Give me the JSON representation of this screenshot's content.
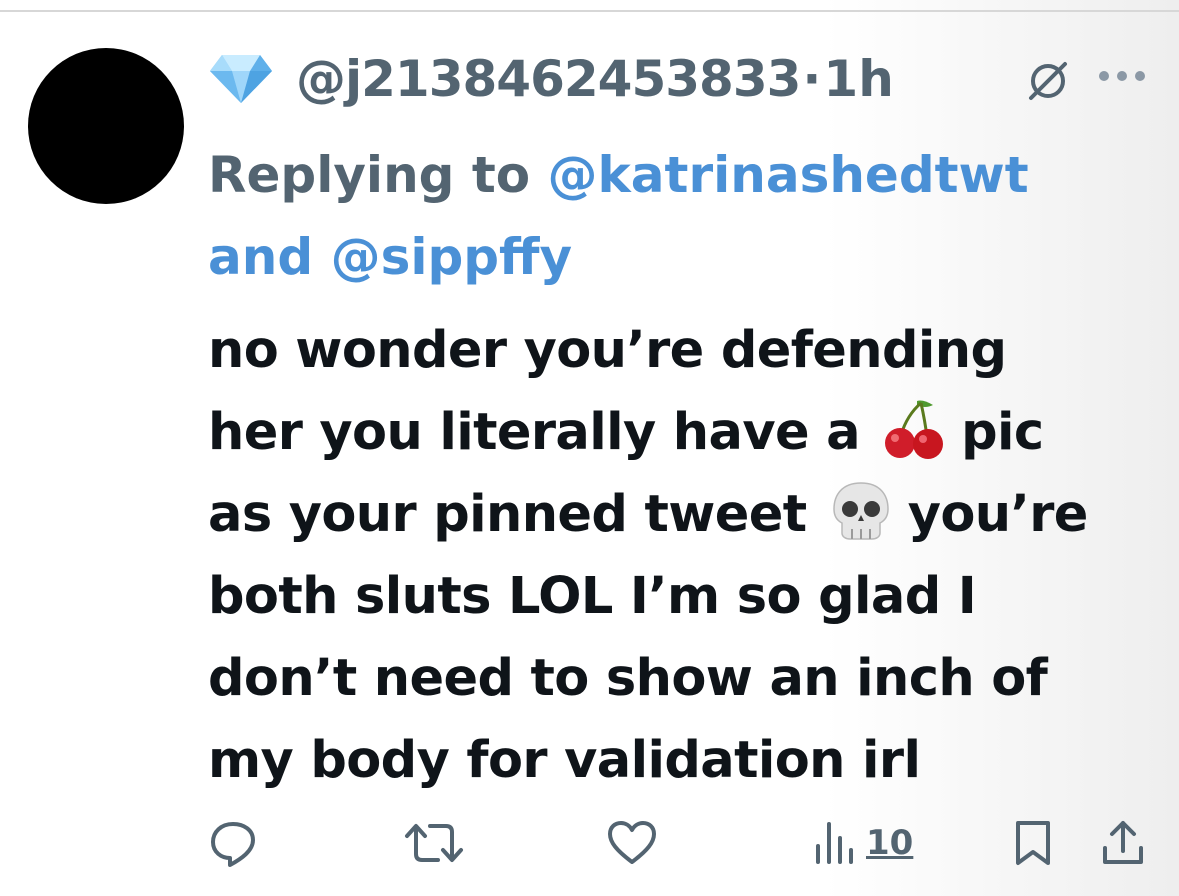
{
  "tweet": {
    "badge_icon": "diamond-icon",
    "handle": "@j2138462453833",
    "separator": "·",
    "time": "1h",
    "reply_prefix": "Replying to",
    "reply_mention_1": "@katrinashedtwt",
    "reply_and": "and",
    "reply_mention_2": "@sippffy",
    "text_lines": [
      "no wonder you’re defending",
      "her you literally have a",
      "pic",
      "as your pinned tweet",
      "you’re",
      "both sluts LOL I’m so glad I",
      "don’t need to show an inch of",
      "my body for validation irl"
    ],
    "emojis": [
      "cherries-emoji",
      "skull-emoji"
    ]
  },
  "actions": {
    "views_count": "10",
    "icons": [
      "reply-icon",
      "retweet-icon",
      "like-icon",
      "views-icon",
      "bookmark-icon",
      "share-icon"
    ]
  },
  "colors": {
    "secondary_text": "#536471",
    "link": "#4a90d6",
    "primary_text": "#0f1419"
  }
}
